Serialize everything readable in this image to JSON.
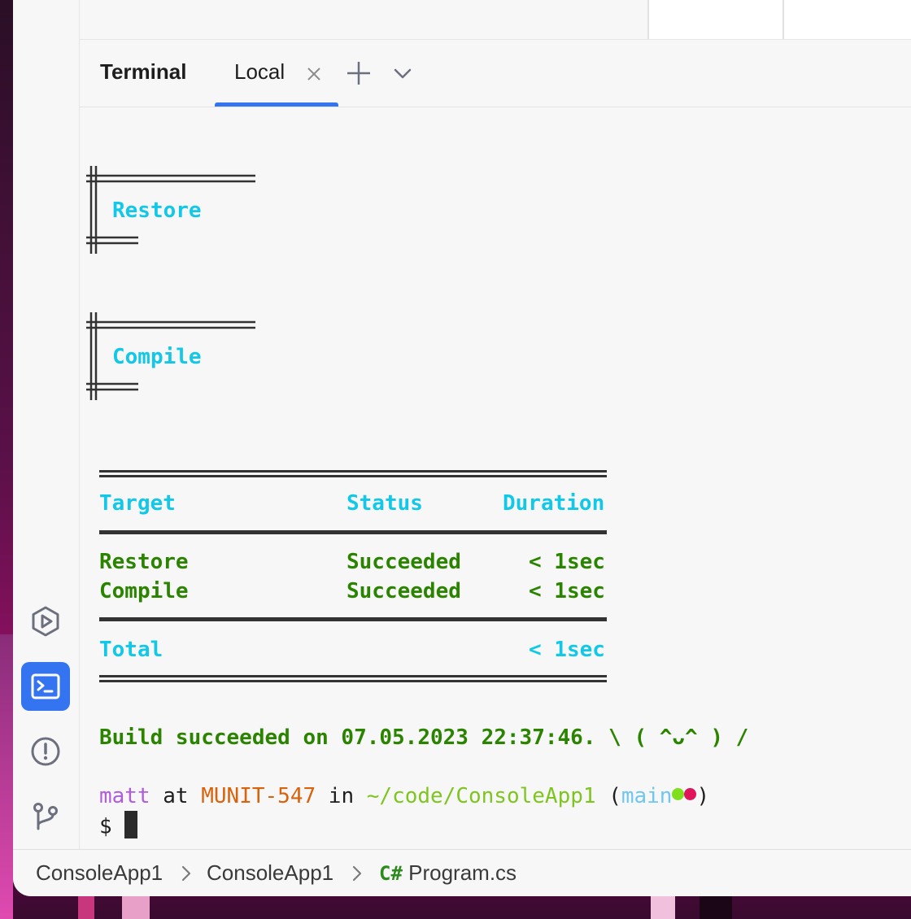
{
  "terminal": {
    "title": "Terminal",
    "tab_label": "Local",
    "sections": [
      "Restore",
      "Compile"
    ],
    "table": {
      "headers": [
        "Target",
        "Status",
        "Duration"
      ],
      "rows": [
        [
          "Restore",
          "Succeeded",
          "< 1sec"
        ],
        [
          "Compile",
          "Succeeded",
          "< 1sec"
        ]
      ],
      "total_label": "Total",
      "total_value": "< 1sec"
    },
    "build_message": "Build succeeded on 07.05.2023 22:37:46. \\ ( ^ᴗ^ ) /",
    "prompt": {
      "user": "matt",
      "at": "at",
      "host": "MUNIT-547",
      "in": "in",
      "path": "~/code/ConsoleApp1",
      "open_paren": "(",
      "branch": "main",
      "close_paren": ")",
      "symbol": "$"
    }
  },
  "breadcrumb": {
    "items": [
      "ConsoleApp1",
      "ConsoleApp1"
    ],
    "file_badge": "C#",
    "file_name": "Program.cs"
  },
  "colors": {
    "accent": "#3574f0",
    "heading_cyan": "#12c8e8",
    "success_green": "#2a8400",
    "dot_green": "#7ee01c",
    "dot_red": "#e0145a"
  },
  "icons": [
    "run-icon",
    "terminal-icon",
    "problems-icon",
    "git-icon",
    "close-icon",
    "plus-icon",
    "chevron-down-icon",
    "chevron-right-icon"
  ]
}
